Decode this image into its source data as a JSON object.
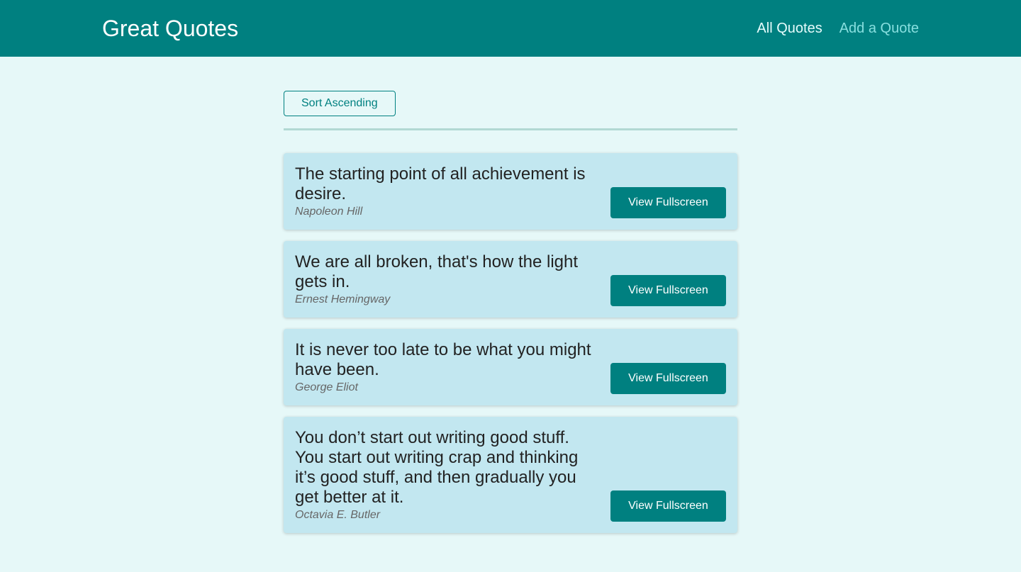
{
  "header": {
    "title": "Great Quotes",
    "nav": [
      {
        "label": "All Quotes",
        "active": true
      },
      {
        "label": "Add a Quote",
        "active": false
      }
    ]
  },
  "toolbar": {
    "sort_label": "Sort Ascending"
  },
  "quotes": [
    {
      "text": "The starting point of all achievement is desire.",
      "author": "Napoleon Hill",
      "button": "View Fullscreen"
    },
    {
      "text": "We are all broken, that's how the light gets in.",
      "author": "Ernest Hemingway",
      "button": "View Fullscreen"
    },
    {
      "text": "It is never too late to be what you might have been.",
      "author": "George Eliot",
      "button": "View Fullscreen"
    },
    {
      "text": "You don’t start out writing good stuff. You start out writing crap and thinking it’s good stuff, and then gradually you get better at it.",
      "author": "Octavia E. Butler",
      "button": "View Fullscreen"
    }
  ],
  "colors": {
    "brand": "#008080",
    "background": "#e6f8f8",
    "card": "#c2e7f0"
  }
}
